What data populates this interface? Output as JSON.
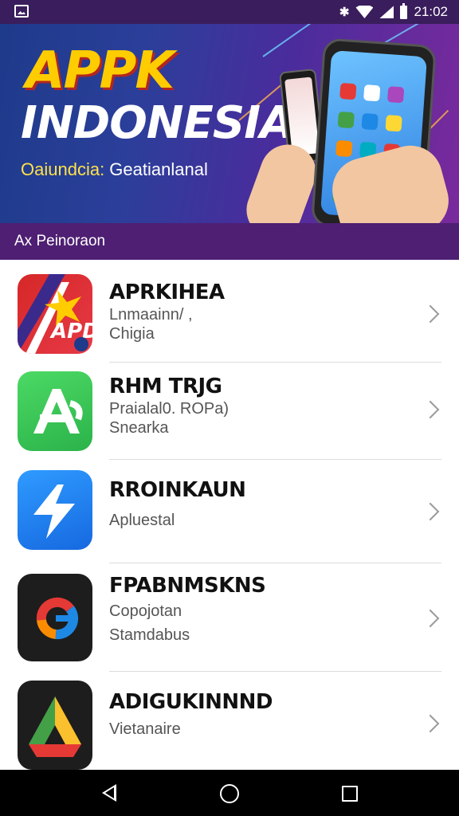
{
  "status_bar": {
    "time": "21:02",
    "bluetooth": "✱"
  },
  "banner": {
    "logo_apk": "APPK",
    "logo_title": "INDONESIA",
    "tagline_part1": "Oaiundcia:",
    "tagline_part2": " Geatianlanal"
  },
  "section": {
    "title": "Ax Peinoraon"
  },
  "apps": [
    {
      "title": "APRKIHEA",
      "line1": "Lnmaainn/   ,",
      "line2": "Chigia",
      "icon": "apk-logo-icon"
    },
    {
      "title": "RHM TRJG",
      "line1": "Praialal0. ROPa)",
      "line2": "Snearka",
      "icon": "green-a-icon"
    },
    {
      "title": "RROINKAUN",
      "line1": "Apluestal",
      "line2": "",
      "icon": "lightning-icon"
    },
    {
      "title": "FPABNMSKNS",
      "line1": "Copojotan",
      "line2": "Stamdabus",
      "icon": "ring-logo-icon"
    },
    {
      "title": "ADIGUKINNND",
      "line1": "Vietanaire",
      "line2": "",
      "icon": "triangle-logo-icon"
    }
  ],
  "colors": {
    "section_bg": "#4e1f73",
    "status_bg": "#3a1d5c",
    "accent_yellow": "#ffcc00"
  }
}
